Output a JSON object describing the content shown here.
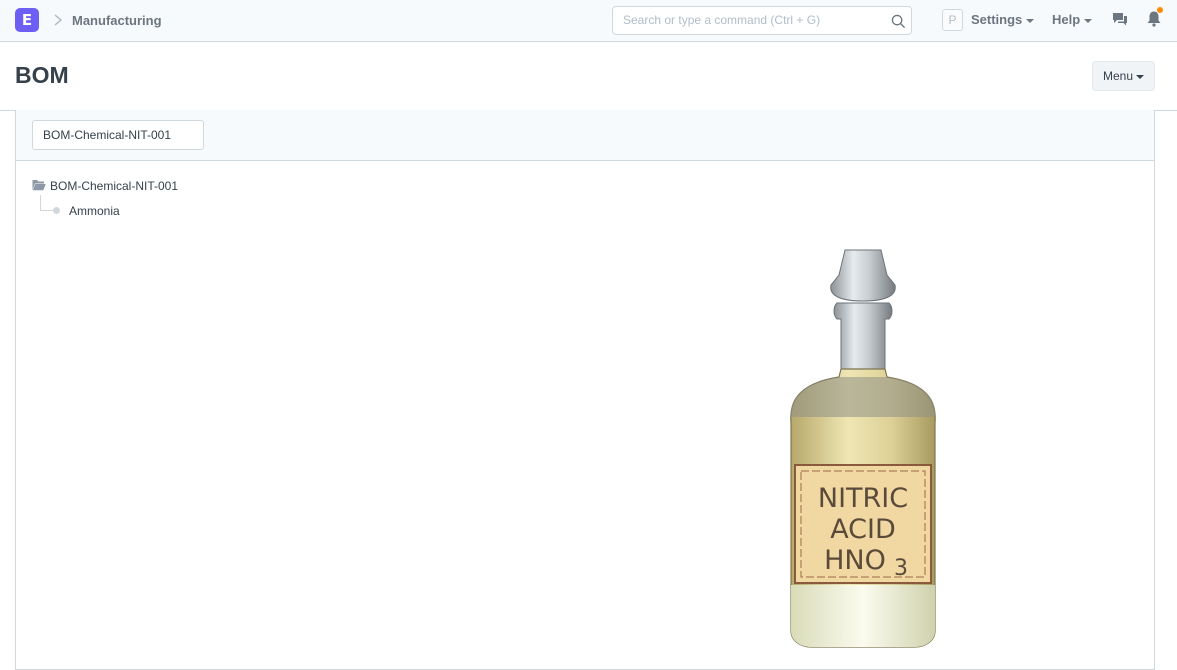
{
  "navbar": {
    "logo_letter": "E",
    "breadcrumb": "Manufacturing",
    "search_placeholder": "Search or type a command (Ctrl + G)",
    "avatar_letter": "P",
    "settings_label": "Settings",
    "help_label": "Help",
    "notification_color": "#ff8a00"
  },
  "page": {
    "title": "BOM",
    "menu_label": "Menu"
  },
  "filter": {
    "value": "BOM-Chemical-NIT-001"
  },
  "tree": {
    "root_label": "BOM-Chemical-NIT-001",
    "children": [
      {
        "label": "Ammonia"
      }
    ]
  },
  "image": {
    "label_line1": "NITRIC",
    "label_line2": "ACID",
    "label_line3": "HNO",
    "label_subscript": "3"
  },
  "icons": {
    "brand": "logo-icon",
    "chevron": "chevron-right-icon",
    "search": "search-icon",
    "chat": "chat-icon",
    "bell": "bell-icon",
    "folder": "folder-open-icon"
  },
  "colors": {
    "brand": "#6e5ff4",
    "navbar_bg": "#f7fafc",
    "border": "#d1d8dd",
    "text": "#36414c"
  }
}
